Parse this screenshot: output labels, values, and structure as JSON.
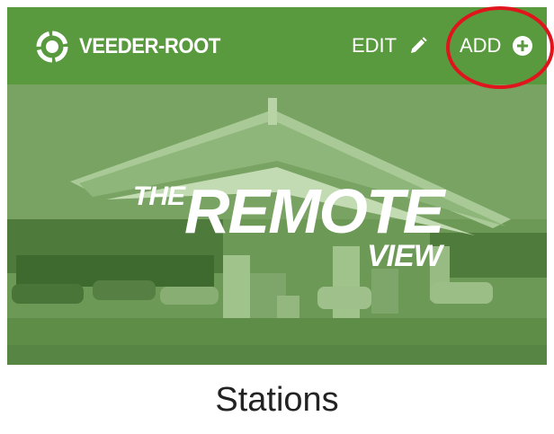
{
  "header": {
    "logo_text": "VEEDER-ROOT",
    "edit_label": "EDIT",
    "add_label": "ADD",
    "logo_icon": "veeder-root-logo-icon",
    "edit_icon": "pencil-icon",
    "add_icon": "plus-circle-icon"
  },
  "hero": {
    "title_small": "THE",
    "title_main": "REMOTE",
    "title_sub": "VIEW"
  },
  "page": {
    "title": "Stations"
  },
  "colors": {
    "header_bg": "#5a9a3f",
    "hero_tint": "#6f9a58",
    "annotation": "#e0141c",
    "text_dark": "#222222"
  }
}
